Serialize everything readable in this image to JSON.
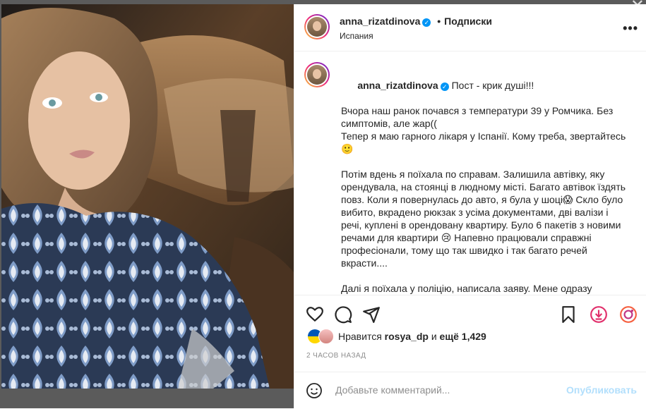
{
  "post": {
    "username": "anna_rizatdinova",
    "dot": "•",
    "follow_label": "Подписки",
    "location": "Испания",
    "more_label": "•••",
    "caption_title": "Пост - крик душі!!!",
    "caption_body": "\nВчора наш ранок почався з температури 39 у Ромчика. Без симптомів, але жар((\nТепер я маю гарного лікаря у Іспанії. Кому треба, звертайтесь 🙂\n\nПотім вдень я поїхала по справам. Залишила автівку, яку орендувала, на стоянці в людному місті. Багато автівок їздять повз. Коли я повернулась до авто, я була у шоці😱 Скло було вибито, вкрадено рюкзак з усіма документами, дві валізи і речі, куплені в орендовану квартиру. Було 6 пакетів з новими речами для квартири 😢 Напевно працювали справжні професіонали, тому що так швидко і так багато речей вкрасти....\n\nДалі я поїхала у поліцію, написала заяву. Мене одразу попередили, що навряд чи поліція щось знайде..."
  },
  "likes": {
    "prefix": "Нравится",
    "user": "rosya_dp",
    "middle": "и",
    "more": "ещё 1,429"
  },
  "time": "2 ЧАСОВ НАЗАД",
  "comment": {
    "placeholder": "Добавьте комментарий...",
    "publish_label": "Опубликовать"
  },
  "overlay": {
    "close_label": "✕"
  }
}
